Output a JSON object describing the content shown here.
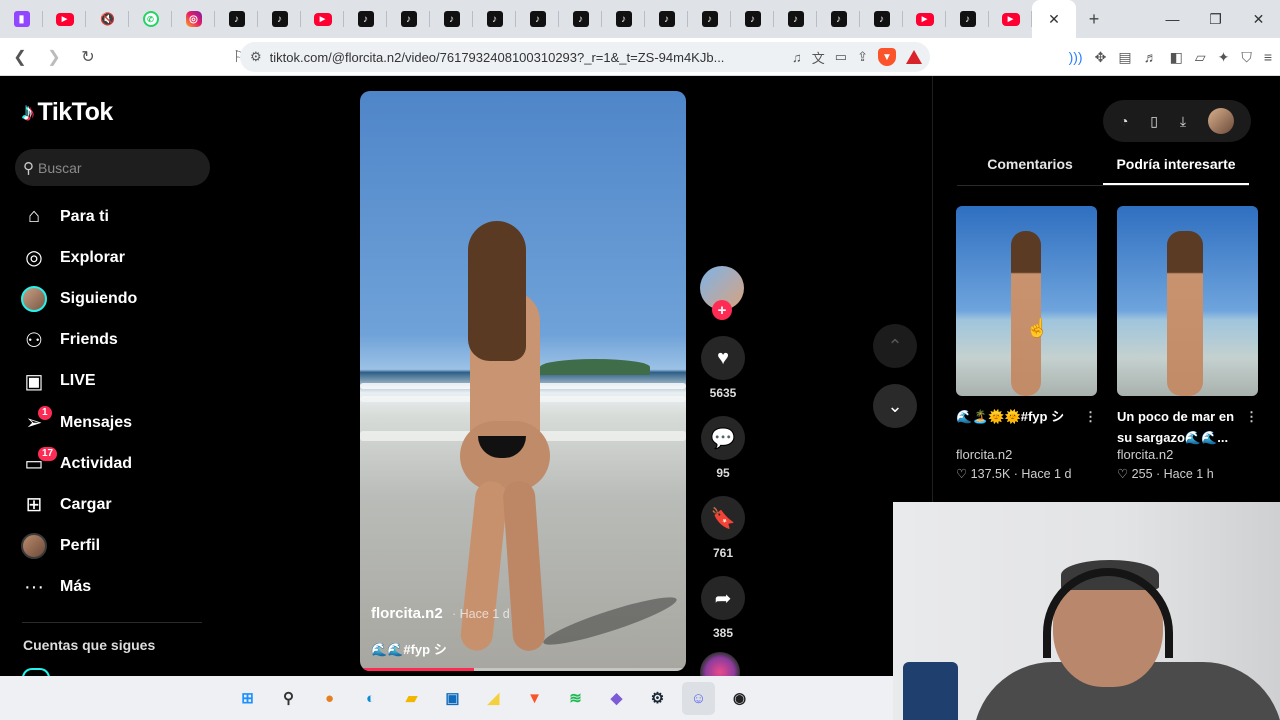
{
  "browser": {
    "tabs": [
      {
        "icon": "twitch-icon",
        "glyph": "▮"
      },
      {
        "icon": "youtube-icon",
        "glyph": "▶"
      },
      {
        "icon": "muted-speaker-icon",
        "glyph": "🔇"
      },
      {
        "icon": "whatsapp-icon",
        "glyph": "✆"
      },
      {
        "icon": "instagram-icon",
        "glyph": "◎"
      },
      {
        "icon": "tiktok-icon",
        "glyph": "♪"
      },
      {
        "icon": "tiktok-icon",
        "glyph": "♪"
      },
      {
        "icon": "youtube-icon",
        "glyph": "▶"
      },
      {
        "icon": "tiktok-icon",
        "glyph": "♪"
      },
      {
        "icon": "tiktok-icon",
        "glyph": "♪"
      },
      {
        "icon": "tiktok-icon",
        "glyph": "♪"
      },
      {
        "icon": "tiktok-icon",
        "glyph": "♪"
      },
      {
        "icon": "tiktok-icon",
        "glyph": "♪"
      },
      {
        "icon": "tiktok-icon",
        "glyph": "♪"
      },
      {
        "icon": "tiktok-icon",
        "glyph": "♪"
      },
      {
        "icon": "tiktok-icon",
        "glyph": "♪"
      },
      {
        "icon": "tiktok-icon",
        "glyph": "♪"
      },
      {
        "icon": "tiktok-icon",
        "glyph": "♪"
      },
      {
        "icon": "tiktok-icon",
        "glyph": "♪"
      },
      {
        "icon": "tiktok-icon",
        "glyph": "♪"
      },
      {
        "icon": "tiktok-icon",
        "glyph": "♪"
      },
      {
        "icon": "youtube-icon",
        "glyph": "▶"
      },
      {
        "icon": "tiktok-icon",
        "glyph": "♪"
      },
      {
        "icon": "youtube-icon",
        "glyph": "▶"
      }
    ],
    "active_tab_close": "✕",
    "new_tab": "+",
    "url": "tiktok.com/@florcita.n2/video/7617932408100310293?_r=1&_t=ZS-94m4KJb..."
  },
  "tiktok": {
    "brand": "TikTok",
    "search_placeholder": "Buscar",
    "nav": [
      {
        "label": "Para ti",
        "icon": "home-icon",
        "glyph": "⌂"
      },
      {
        "label": "Explorar",
        "icon": "compass-icon",
        "glyph": "◎"
      },
      {
        "label": "Siguiendo",
        "icon": "following-avatar-icon",
        "glyph": ""
      },
      {
        "label": "Friends",
        "icon": "friends-icon",
        "glyph": "⚇"
      },
      {
        "label": "LIVE",
        "icon": "live-tv-icon",
        "glyph": "▣"
      },
      {
        "label": "Mensajes",
        "icon": "paper-plane-icon",
        "glyph": "➢",
        "badge": "1"
      },
      {
        "label": "Actividad",
        "icon": "activity-icon",
        "glyph": "▭",
        "badge": "17"
      },
      {
        "label": "Cargar",
        "icon": "upload-plus-icon",
        "glyph": "⊞"
      },
      {
        "label": "Perfil",
        "icon": "profile-avatar-icon",
        "glyph": ""
      },
      {
        "label": "Más",
        "icon": "more-dots-icon",
        "glyph": "···"
      }
    ],
    "following_title": "Cuentas que sigues"
  },
  "video": {
    "author": "florcita.n2",
    "time": "· Hace 1 d",
    "caption": "🌊🌊#fyp シ",
    "progress": 0.35,
    "likes": "5635",
    "comments": "95",
    "saves": "761",
    "shares": "385"
  },
  "panel": {
    "tabs": [
      "Comentarios",
      "Podría interesarte"
    ],
    "cards": [
      {
        "title": "🌊🏝️🌞🌞#fyp シ",
        "user": "florcita.n2",
        "meta": "♡ 137.5K · Hace 1 d"
      },
      {
        "title": "Un poco de mar en su sargazo🌊🌊...",
        "user": "florcita.n2",
        "meta": "♡ 255 · Hace 1 h"
      }
    ]
  },
  "taskbar": [
    {
      "icon": "windows-start-icon",
      "glyph": "⊞",
      "color": "#1e90ff"
    },
    {
      "icon": "search-icon",
      "glyph": "⚲",
      "color": "#333333"
    },
    {
      "icon": "colorful-app-icon",
      "glyph": "●",
      "color": "#e67e22"
    },
    {
      "icon": "edge-icon",
      "glyph": "◐",
      "color": "#0b8ad6"
    },
    {
      "icon": "file-explorer-icon",
      "glyph": "▰",
      "color": "#f3b600"
    },
    {
      "icon": "store-icon",
      "glyph": "▣",
      "color": "#0f6cbd"
    },
    {
      "icon": "sticky-notes-icon",
      "glyph": "◢",
      "color": "#f4d03f"
    },
    {
      "icon": "brave-icon",
      "glyph": "▼",
      "color": "#fb542b"
    },
    {
      "icon": "spotify-icon",
      "glyph": "≋",
      "color": "#1db954"
    },
    {
      "icon": "obsidian-icon",
      "glyph": "◆",
      "color": "#7c5cd6"
    },
    {
      "icon": "steam-icon",
      "glyph": "⚙",
      "color": "#1b2838"
    },
    {
      "icon": "discord-icon",
      "glyph": "☺",
      "color": "#5865f2"
    },
    {
      "icon": "obs-icon",
      "glyph": "◉",
      "color": "#222222"
    }
  ]
}
